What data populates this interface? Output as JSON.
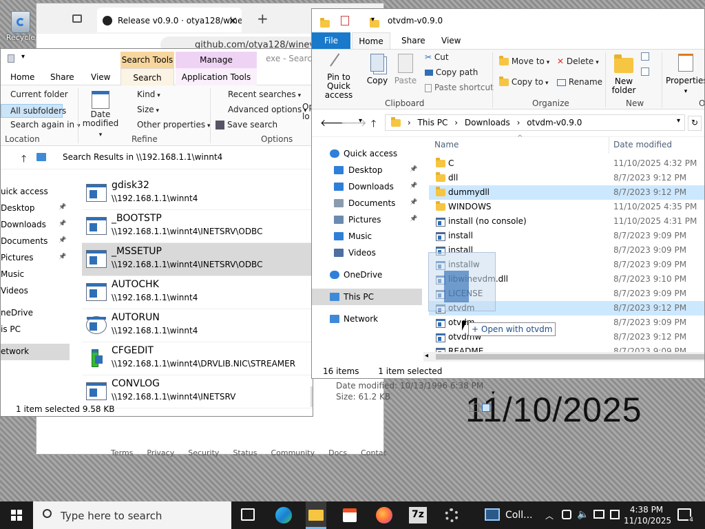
{
  "desktop": {
    "recycle_label": "Recycle",
    "big_date": "11/10/2025"
  },
  "browser": {
    "tab_title": "Release v0.9.0 · otya128/winevdm",
    "tab_close": "×",
    "new_tab": "+",
    "address": "github.com/otya128/winevdm",
    "footer_links": [
      "Terms",
      "Privacy",
      "Security",
      "Status",
      "Community",
      "Docs",
      "Contact"
    ]
  },
  "search_explorer": {
    "title_input": "exe - Search",
    "contextual_tabs": {
      "search_tools": "Search Tools",
      "manage": "Manage"
    },
    "tabs": [
      "Home",
      "Share",
      "View",
      "Search",
      "Application Tools"
    ],
    "ribbon": {
      "location": {
        "current_folder": "Current folder",
        "all_subfolders": "All subfolders",
        "search_again": "Search again in",
        "group": "Location"
      },
      "refine": {
        "date_modified": "Date modified",
        "kind": "Kind",
        "size": "Size",
        "other_properties": "Other properties",
        "group": "Refine"
      },
      "options": {
        "recent_searches": "Recent searches",
        "advanced_options": "Advanced options",
        "save_search": "Save search",
        "open_loc": "Op lo",
        "group": "Options"
      }
    },
    "address": "Search Results in \\\\192.168.1.1\\winnt4",
    "nav": [
      {
        "label": "uick access",
        "pinned": false
      },
      {
        "label": "Desktop",
        "pinned": true
      },
      {
        "label": "Downloads",
        "pinned": true
      },
      {
        "label": "Documents",
        "pinned": true
      },
      {
        "label": "Pictures",
        "pinned": true
      },
      {
        "label": "Music",
        "pinned": false
      },
      {
        "label": "Videos",
        "pinned": false
      },
      {
        "label": "neDrive",
        "pinned": false
      },
      {
        "label": "is PC",
        "pinned": false
      },
      {
        "label": "etwork",
        "pinned": false
      }
    ],
    "results": [
      {
        "name": "gdisk32",
        "path": "\\\\192.168.1.1\\winnt4",
        "icon": "shield-exe-icon"
      },
      {
        "name": "_BOOTSTP",
        "path": "\\\\192.168.1.1\\winnt4\\INETSRV\\ODBC",
        "icon": "exe-icon"
      },
      {
        "name": "_MSSETUP",
        "path": "\\\\192.168.1.1\\winnt4\\INETSRV\\ODBC",
        "icon": "exe-icon"
      },
      {
        "name": "AUTOCHK",
        "path": "\\\\192.168.1.1\\winnt4",
        "icon": "exe-icon"
      },
      {
        "name": "AUTORUN",
        "path": "\\\\192.168.1.1\\winnt4",
        "icon": "cd-icon"
      },
      {
        "name": "CFGEDIT",
        "path": "\\\\192.168.1.1\\winnt4\\DRVLIB.NIC\\STREAMER",
        "icon": "green-exe-icon"
      },
      {
        "name": "CONVLOG",
        "path": "\\\\192.168.1.1\\winnt4\\INETSRV",
        "icon": "exe-icon"
      }
    ],
    "detail": {
      "date_modified": "Date modified: 10/13/1996 6:38 PM",
      "size": "Size: 61.2 KB"
    },
    "status": {
      "count": "1 item selected  9.58 KB"
    }
  },
  "otvdm_explorer": {
    "title": "otvdm-v0.9.0",
    "tabs": [
      "File",
      "Home",
      "Share",
      "View"
    ],
    "ribbon": {
      "pin": "Pin to Quick access",
      "copy": "Copy",
      "paste": "Paste",
      "cut": "Cut",
      "copy_path": "Copy path",
      "paste_shortcut": "Paste shortcut",
      "clipboard": "Clipboard",
      "move_to": "Move to",
      "copy_to": "Copy to",
      "delete": "Delete",
      "rename": "Rename",
      "organize": "Organize",
      "new_folder": "New folder",
      "new": "New",
      "properties": "Properties",
      "open_group": "O"
    },
    "breadcrumb": [
      "This PC",
      "Downloads",
      "otvdm-v0.9.0"
    ],
    "columns": {
      "name": "Name",
      "date": "Date modified"
    },
    "nav": [
      {
        "label": "Quick access",
        "icon": "star-icon",
        "pinned": false,
        "indent": 0
      },
      {
        "label": "Desktop",
        "icon": "desktop-icon",
        "pinned": true,
        "indent": 1
      },
      {
        "label": "Downloads",
        "icon": "downloads-icon",
        "pinned": true,
        "indent": 1
      },
      {
        "label": "Documents",
        "icon": "documents-icon",
        "pinned": true,
        "indent": 1
      },
      {
        "label": "Pictures",
        "icon": "pictures-icon",
        "pinned": true,
        "indent": 1
      },
      {
        "label": "Music",
        "icon": "music-icon",
        "pinned": false,
        "indent": 1
      },
      {
        "label": "Videos",
        "icon": "videos-icon",
        "pinned": false,
        "indent": 1
      },
      {
        "label": "OneDrive",
        "icon": "cloud-icon",
        "pinned": false,
        "indent": 0
      },
      {
        "label": "This PC",
        "icon": "pc-icon",
        "pinned": false,
        "indent": 0
      },
      {
        "label": "Network",
        "icon": "network-icon",
        "pinned": false,
        "indent": 0
      }
    ],
    "files": [
      {
        "name": "C",
        "date": "11/10/2025 4:32 PM",
        "type": "folder"
      },
      {
        "name": "dll",
        "date": "8/7/2023 9:12 PM",
        "type": "folder"
      },
      {
        "name": "dummydll",
        "date": "8/7/2023 9:12 PM",
        "type": "folder"
      },
      {
        "name": "WINDOWS",
        "date": "11/10/2025 4:35 PM",
        "type": "folder"
      },
      {
        "name": "install (no console)",
        "date": "11/10/2025 4:31 PM",
        "type": "script"
      },
      {
        "name": "install",
        "date": "8/7/2023 9:09 PM",
        "type": "script"
      },
      {
        "name": "install",
        "date": "8/7/2023 9:09 PM",
        "type": "script"
      },
      {
        "name": "installw",
        "date": "8/7/2023 9:09 PM",
        "type": "script"
      },
      {
        "name": "libwinevdm.dll",
        "date": "8/7/2023 9:10 PM",
        "type": "dll"
      },
      {
        "name": "LICENSE",
        "date": "8/7/2023 9:09 PM",
        "type": "file"
      },
      {
        "name": "otvdm",
        "date": "8/7/2023 9:12 PM",
        "type": "exe"
      },
      {
        "name": "otvdm",
        "date": "8/7/2023 9:09 PM",
        "type": "script"
      },
      {
        "name": "otvdmw",
        "date": "8/7/2023 9:12 PM",
        "type": "exe"
      },
      {
        "name": "README",
        "date": "8/7/2023 9:09 PM",
        "type": "file"
      }
    ],
    "drag_tooltip": "+ Open with otvdm",
    "status": {
      "count": "16 items",
      "selected": "1 item selected"
    }
  },
  "taskbar": {
    "search_placeholder": "Type here to search",
    "active_app_label": "Coll...",
    "time": "4:38 PM",
    "date": "11/10/2025",
    "notifications": "4"
  }
}
